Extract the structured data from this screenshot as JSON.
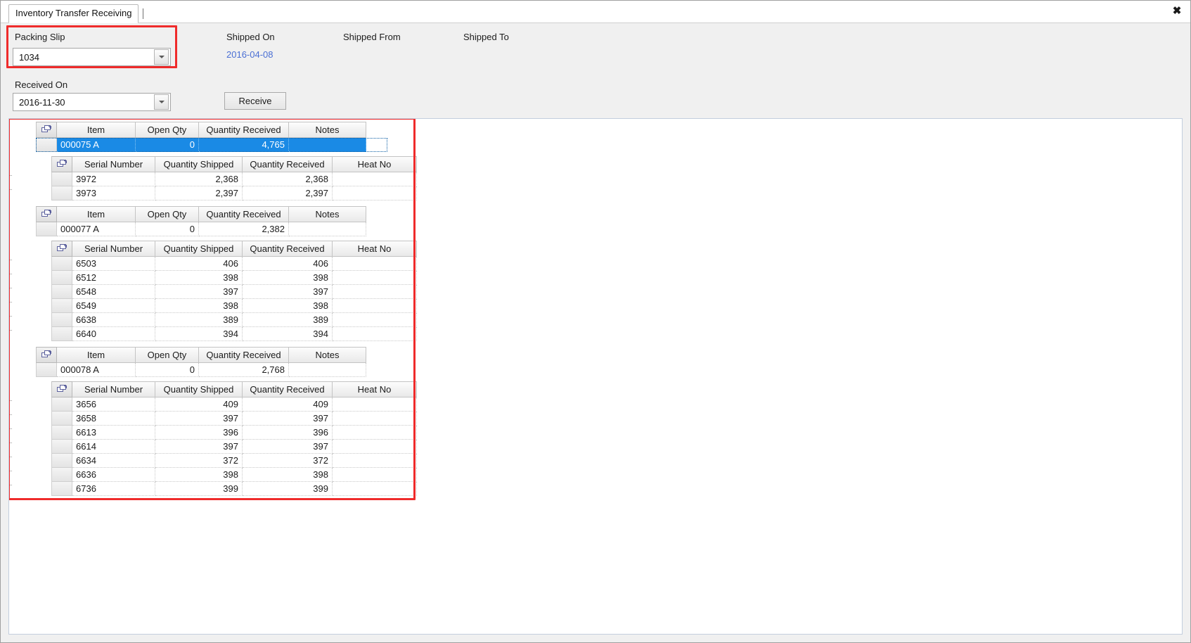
{
  "window": {
    "tab_title": "Inventory Transfer Receiving",
    "close_label": "✖"
  },
  "header": {
    "packing_slip_label": "Packing Slip",
    "packing_slip_value": "1034",
    "received_on_label": "Received On",
    "received_on_value": "2016-11-30",
    "shipped_on_label": "Shipped On",
    "shipped_on_value": "2016-04-08",
    "shipped_from_label": "Shipped From",
    "shipped_from_value": "",
    "shipped_to_label": "Shipped To",
    "shipped_to_value": "",
    "receive_button": "Receive",
    "highlight_color": "#ef2b2b",
    "link_color": "#4a6fd4"
  },
  "grid": {
    "master_columns": [
      "Item",
      "Open Qty",
      "Quantity Received",
      "Notes"
    ],
    "detail_columns": [
      "Serial Number",
      "Quantity Shipped",
      "Quantity Received",
      "Heat No"
    ],
    "selection_color": "#1a8ae5",
    "groups": [
      {
        "item": "000075 A",
        "open_qty": "0",
        "quantity_received": "4,765",
        "notes": "",
        "selected": true,
        "expanded": true,
        "details": [
          {
            "serial": "3972",
            "shipped": "2,368",
            "received": "2,368",
            "heat": ""
          },
          {
            "serial": "3973",
            "shipped": "2,397",
            "received": "2,397",
            "heat": ""
          }
        ]
      },
      {
        "item": "000077 A",
        "open_qty": "0",
        "quantity_received": "2,382",
        "notes": "",
        "selected": false,
        "expanded": true,
        "details": [
          {
            "serial": "6503",
            "shipped": "406",
            "received": "406",
            "heat": ""
          },
          {
            "serial": "6512",
            "shipped": "398",
            "received": "398",
            "heat": ""
          },
          {
            "serial": "6548",
            "shipped": "397",
            "received": "397",
            "heat": ""
          },
          {
            "serial": "6549",
            "shipped": "398",
            "received": "398",
            "heat": ""
          },
          {
            "serial": "6638",
            "shipped": "389",
            "received": "389",
            "heat": ""
          },
          {
            "serial": "6640",
            "shipped": "394",
            "received": "394",
            "heat": ""
          }
        ]
      },
      {
        "item": "000078 A",
        "open_qty": "0",
        "quantity_received": "2,768",
        "notes": "",
        "selected": false,
        "expanded": true,
        "details": [
          {
            "serial": "3656",
            "shipped": "409",
            "received": "409",
            "heat": ""
          },
          {
            "serial": "3658",
            "shipped": "397",
            "received": "397",
            "heat": ""
          },
          {
            "serial": "6613",
            "shipped": "396",
            "received": "396",
            "heat": ""
          },
          {
            "serial": "6614",
            "shipped": "397",
            "received": "397",
            "heat": ""
          },
          {
            "serial": "6634",
            "shipped": "372",
            "received": "372",
            "heat": ""
          },
          {
            "serial": "6636",
            "shipped": "398",
            "received": "398",
            "heat": ""
          },
          {
            "serial": "6736",
            "shipped": "399",
            "received": "399",
            "heat": ""
          }
        ]
      }
    ]
  }
}
